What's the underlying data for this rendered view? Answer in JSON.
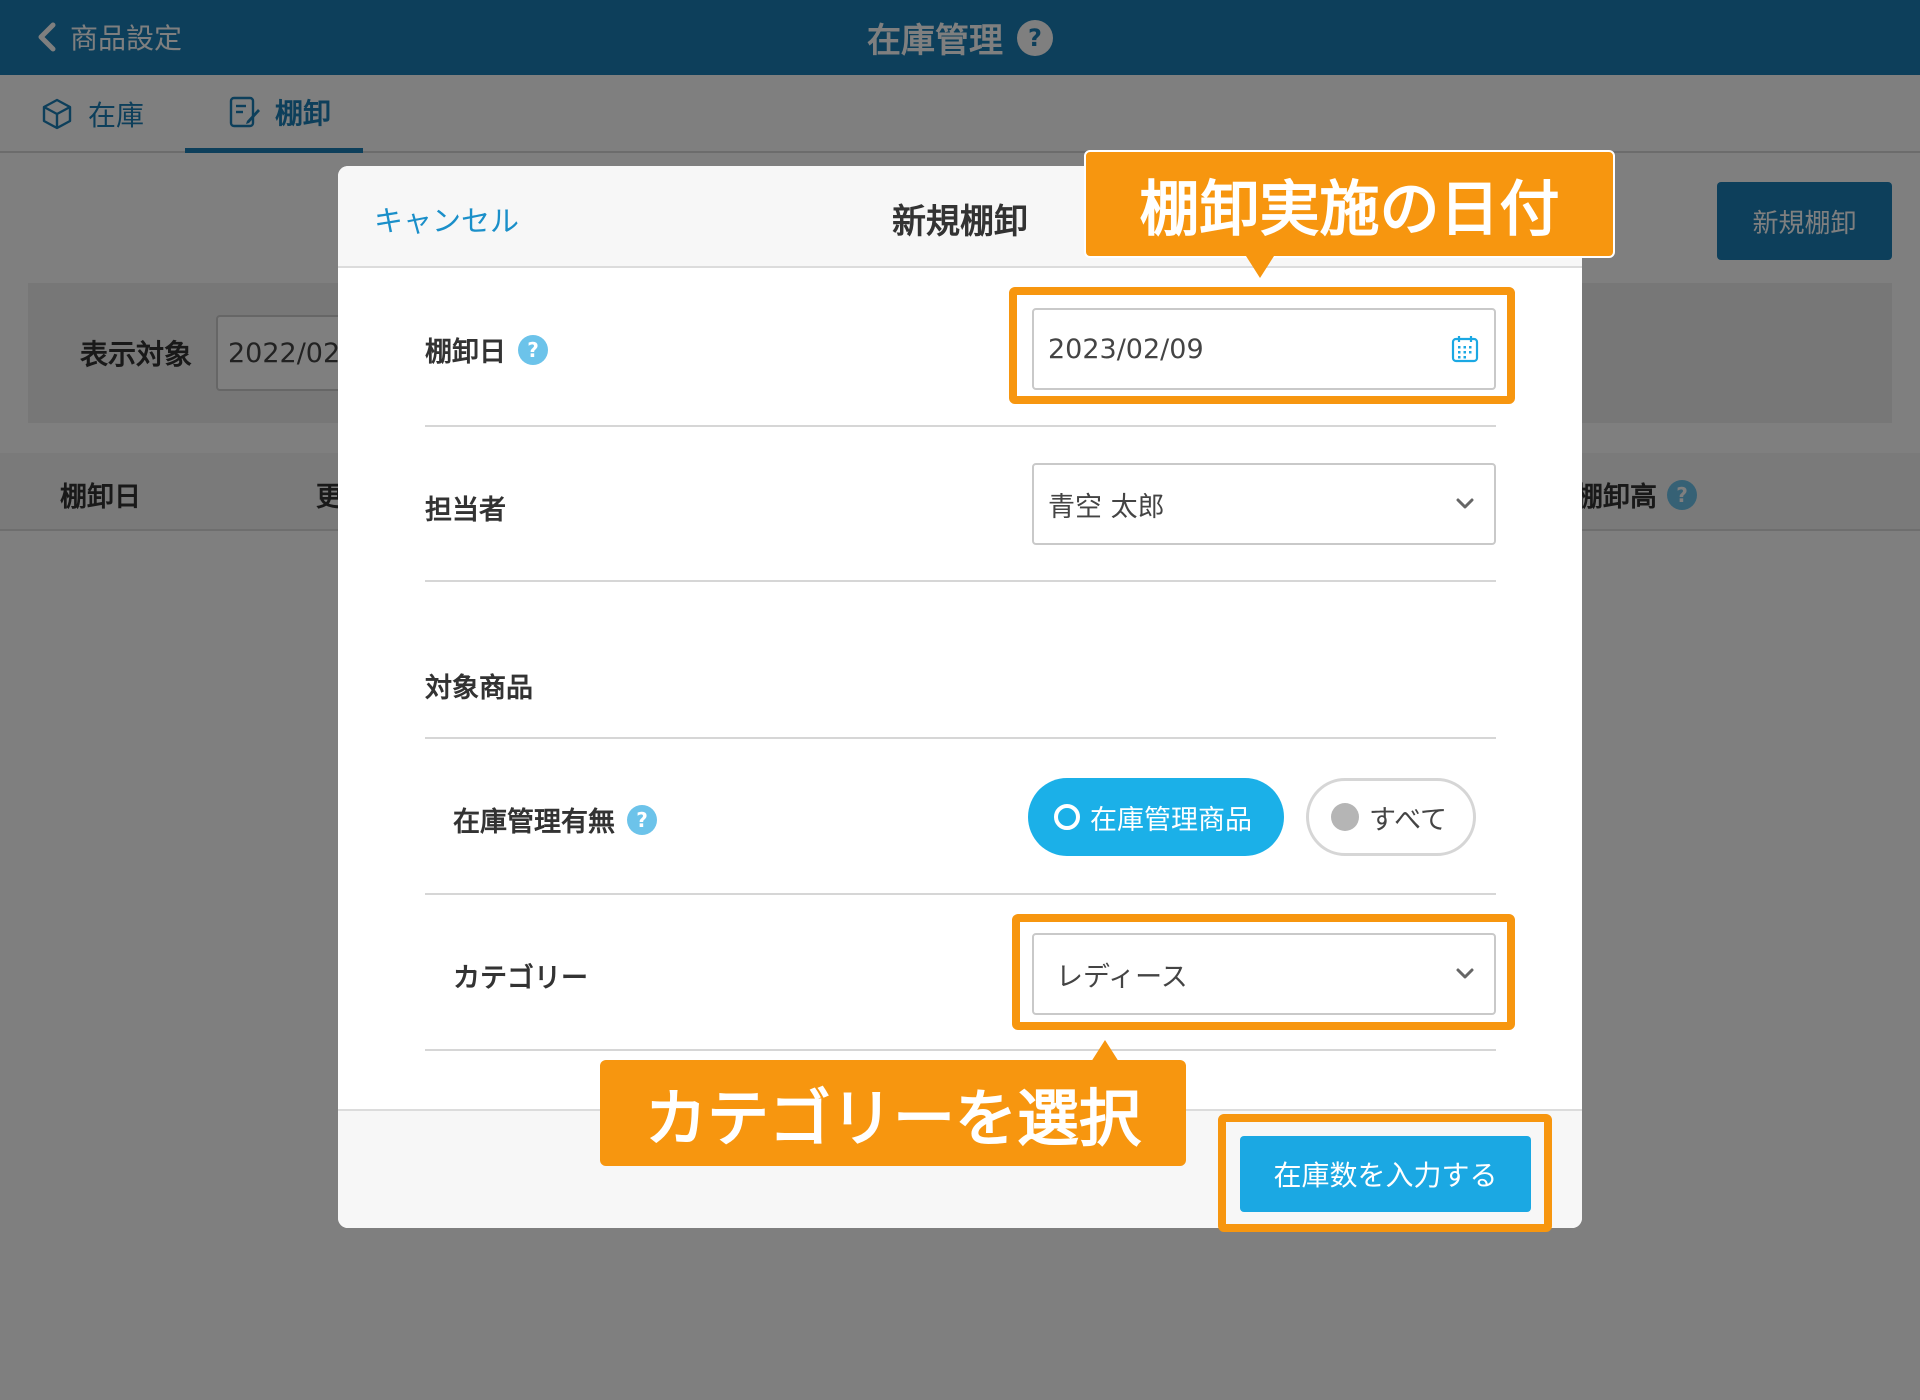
{
  "header": {
    "back_label": "商品設定",
    "title": "在庫管理",
    "help_glyph": "?"
  },
  "tabs": [
    {
      "label": "在庫",
      "active": false
    },
    {
      "label": "棚卸",
      "active": true
    }
  ],
  "background": {
    "new_button_label": "新規棚卸",
    "filter_label": "表示対象",
    "filter_value": "2022/02",
    "columns": [
      "棚卸日",
      "更",
      "棚卸高"
    ]
  },
  "modal": {
    "cancel_label": "キャンセル",
    "title": "新規棚卸",
    "date_label": "棚卸日",
    "date_value": "2023/02/09",
    "assignee_label": "担当者",
    "assignee_value": "青空 太郎",
    "target_section_label": "対象商品",
    "stock_mgmt_label": "在庫管理有無",
    "stock_mgmt_options": [
      {
        "label": "在庫管理商品",
        "selected": true
      },
      {
        "label": "すべて",
        "selected": false
      }
    ],
    "category_label": "カテゴリー",
    "category_value": "レディース",
    "submit_label": "在庫数を入力する"
  },
  "annotations": {
    "date_callout": "棚卸実施の日付",
    "category_callout": "カテゴリーを選択"
  },
  "colors": {
    "primary": "#1a7fb6",
    "accent": "#1bb0e8",
    "annotation": "#f7960f",
    "help_icon": "#6cc3ea"
  }
}
